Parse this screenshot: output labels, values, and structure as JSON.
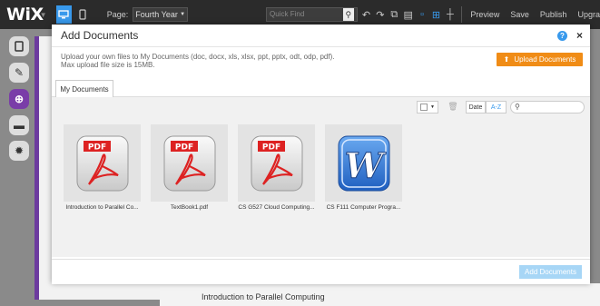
{
  "topbar": {
    "logo": "WiX",
    "page_label": "Page:",
    "page_value": "Fourth Year",
    "search_placeholder": "Quick Find",
    "preview": "Preview",
    "save": "Save",
    "publish": "Publish",
    "upgrade": "Upgra"
  },
  "background": {
    "bottom_label": "Introduction to Parallel Computing"
  },
  "modal": {
    "title": "Add Documents",
    "help": "?",
    "close": "×",
    "description_line1": "Upload your own files to My Documents (doc, docx, xls, xlsx, ppt, pptx, odt, odp, pdf).",
    "description_line2": "Max upload file size is 15MB.",
    "upload_button": "Upload Documents",
    "tab": "My Documents",
    "sort_date": "Date",
    "sort_az": "A-Z",
    "add_button": "Add Documents",
    "accent_color": "#f08c16",
    "documents": [
      {
        "name": "Introduction to Parallel Co...",
        "type": "pdf",
        "icon": "pdf-icon"
      },
      {
        "name": "TextBook1.pdf",
        "type": "pdf",
        "icon": "pdf-icon"
      },
      {
        "name": "CS G527 Cloud Computing...",
        "type": "pdf",
        "icon": "pdf-icon"
      },
      {
        "name": "CS F111 Computer Progra...",
        "type": "word",
        "icon": "word-icon"
      }
    ]
  }
}
